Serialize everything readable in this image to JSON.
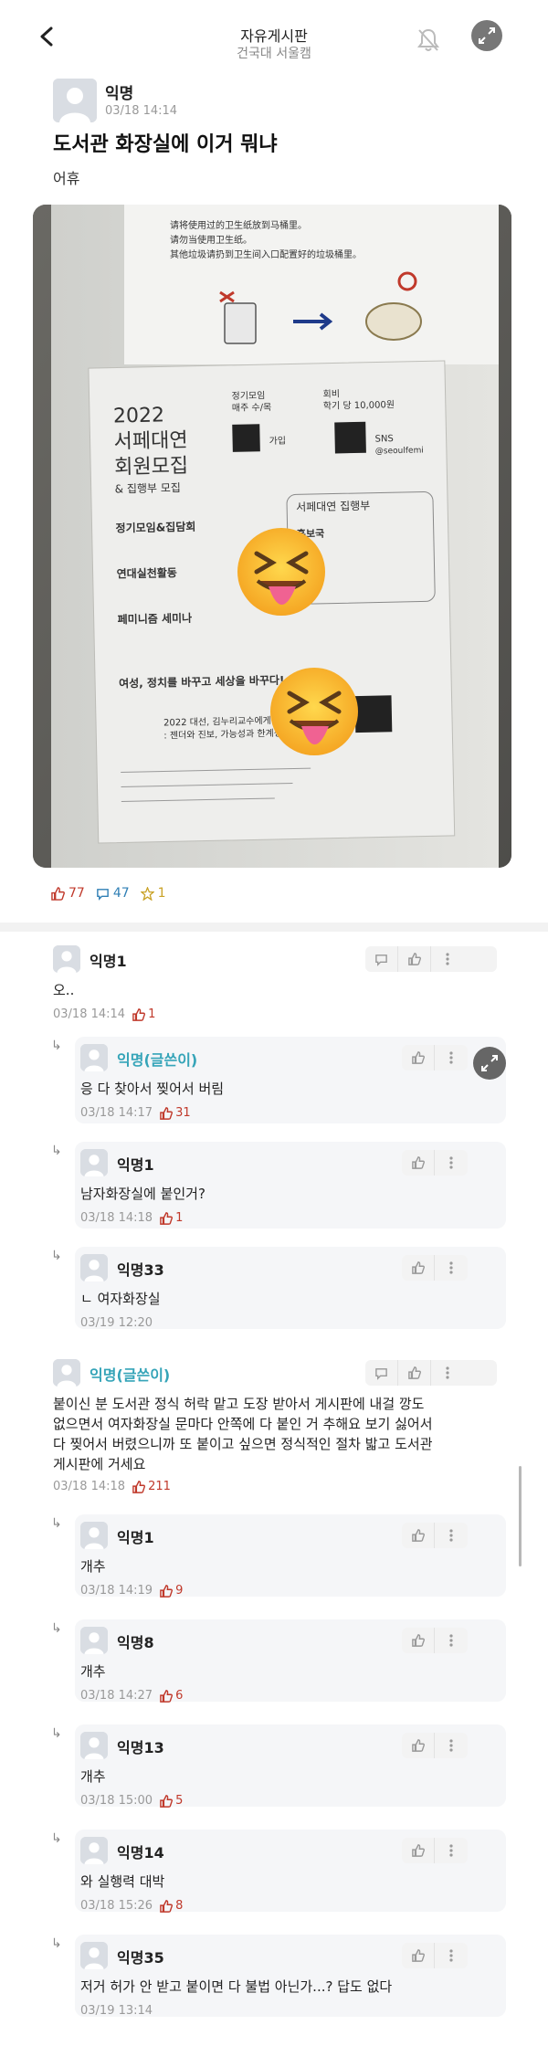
{
  "header": {
    "title": "자유게시판",
    "subtitle": "건국대 서울캠"
  },
  "post": {
    "author": "익명",
    "date": "03/18 14:14",
    "title": "도서관 화장실에 이거 뭐냐",
    "body": "어휴",
    "likes": "77",
    "comments": "47",
    "scraps": "1"
  },
  "photo": {
    "sign_text_1": "请将使用过的卫生纸放到马桶里。",
    "sign_text_2": "请勿当使用卫生纸。",
    "sign_text_3": "其他垃圾请扔到卫生间入口配置好的垃圾桶里。",
    "poster_year": "2022",
    "poster_title_1": "서페대연",
    "poster_title_2": "회원모집",
    "poster_sub": "& 집행부 모집",
    "poster_fee_label": "회비",
    "poster_fee": "학기 당 10,000원",
    "poster_meeting_label": "정기모임",
    "poster_meeting": "매주 수/목",
    "poster_join": "가입",
    "poster_sns": "SNS",
    "poster_sns_handle": "@seoulfemi",
    "poster_section_1": "정기모임&집담회",
    "poster_section_2": "연대실천활동",
    "poster_section_3": "페미니즘 세미나",
    "poster_exec": "서페대연 집행부",
    "poster_exec_role": "홍보국",
    "poster_slogan": "여성, 정치를 바꾸고 세상을 바꾸다!",
    "poster_event": "2022 대선, 김누리교수에게 묻다!",
    "poster_event_2": ": 젠더와 진보, 가능성과 한계성"
  },
  "comments": [
    {
      "author": "익명1",
      "text": "오..",
      "date": "03/18 14:14",
      "likes": "1",
      "reply": false,
      "op": false
    },
    {
      "author": "익명(글쓴이)",
      "text": "응 다 찾아서 찢어서 버림",
      "date": "03/18 14:17",
      "likes": "31",
      "reply": true,
      "op": true
    },
    {
      "author": "익명1",
      "text": "남자화장실에 붙인거?",
      "date": "03/18 14:18",
      "likes": "1",
      "reply": true,
      "op": false
    },
    {
      "author": "익명33",
      "text": "ㄴ 여자화장실",
      "date": "03/19 12:20",
      "likes": "",
      "reply": true,
      "op": false
    },
    {
      "author": "익명(글쓴이)",
      "text_lines": [
        "붙이신 분 도서관 정식 허락 맡고 도장 받아서 게시판에 내걸 깡도",
        "없으면서 여자화장실 문마다 안쪽에 다 붙인 거 추해요 보기 싫어서",
        "다 찢어서 버렸으니까 또 붙이고 싶으면 정식적인 절차 밟고 도서관",
        "게시판에 거세요"
      ],
      "date": "03/18 14:18",
      "likes": "211",
      "reply": false,
      "op": true
    },
    {
      "author": "익명1",
      "text": "개추",
      "date": "03/18 14:19",
      "likes": "9",
      "reply": true,
      "op": false
    },
    {
      "author": "익명8",
      "text": "개추",
      "date": "03/18 14:27",
      "likes": "6",
      "reply": true,
      "op": false
    },
    {
      "author": "익명13",
      "text": "개추",
      "date": "03/18 15:00",
      "likes": "5",
      "reply": true,
      "op": false
    },
    {
      "author": "익명14",
      "text": "와 실행력 대박",
      "date": "03/18 15:26",
      "likes": "8",
      "reply": true,
      "op": false
    },
    {
      "author": "익명35",
      "text": "저거 허가 안 받고 붙이면 다 불법 아닌가...? 답도 없다",
      "date": "03/19 13:14",
      "likes": "",
      "reply": true,
      "op": false
    }
  ],
  "colors": {
    "op": "#35a4b8",
    "like": "#c0392b",
    "comment": "#2f7fb5",
    "scrap": "#c9a227"
  },
  "icons": {
    "back": "chevron-left-icon",
    "bell": "bell-off-icon",
    "comment": "speech-bubble-icon",
    "like": "thumbs-up-icon",
    "more": "vertical-dots-icon",
    "reply": "reply-arrow-icon"
  }
}
